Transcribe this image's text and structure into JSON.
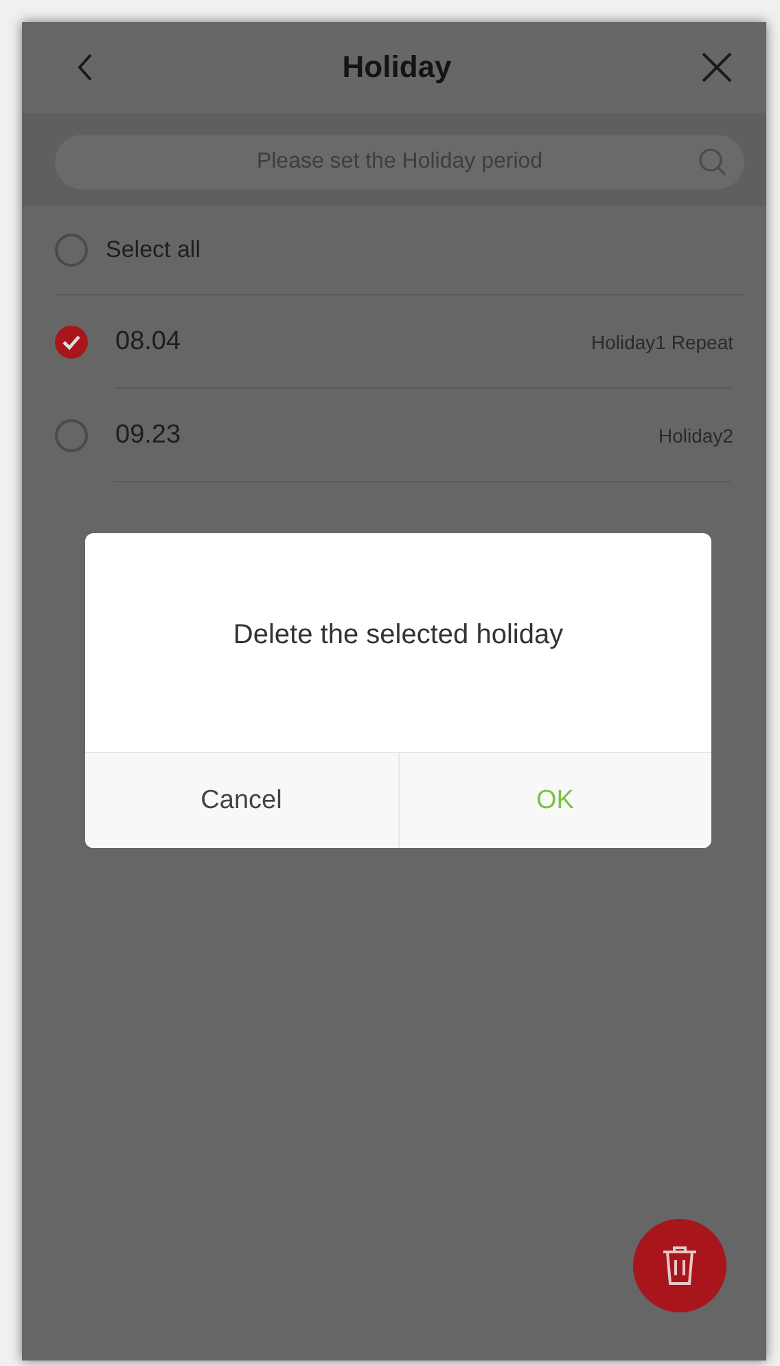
{
  "header": {
    "title": "Holiday"
  },
  "search": {
    "placeholder": "Please set the Holiday period"
  },
  "select_all": {
    "label": "Select all",
    "checked": false
  },
  "holidays": [
    {
      "date": "08.04",
      "note": "Holiday1 Repeat",
      "checked": true
    },
    {
      "date": "09.23",
      "note": "Holiday2",
      "checked": false
    }
  ],
  "dialog": {
    "message": "Delete the selected holiday",
    "buttons": [
      {
        "label": "Cancel",
        "kind": "cancel"
      },
      {
        "label": "OK",
        "kind": "confirm"
      }
    ]
  }
}
